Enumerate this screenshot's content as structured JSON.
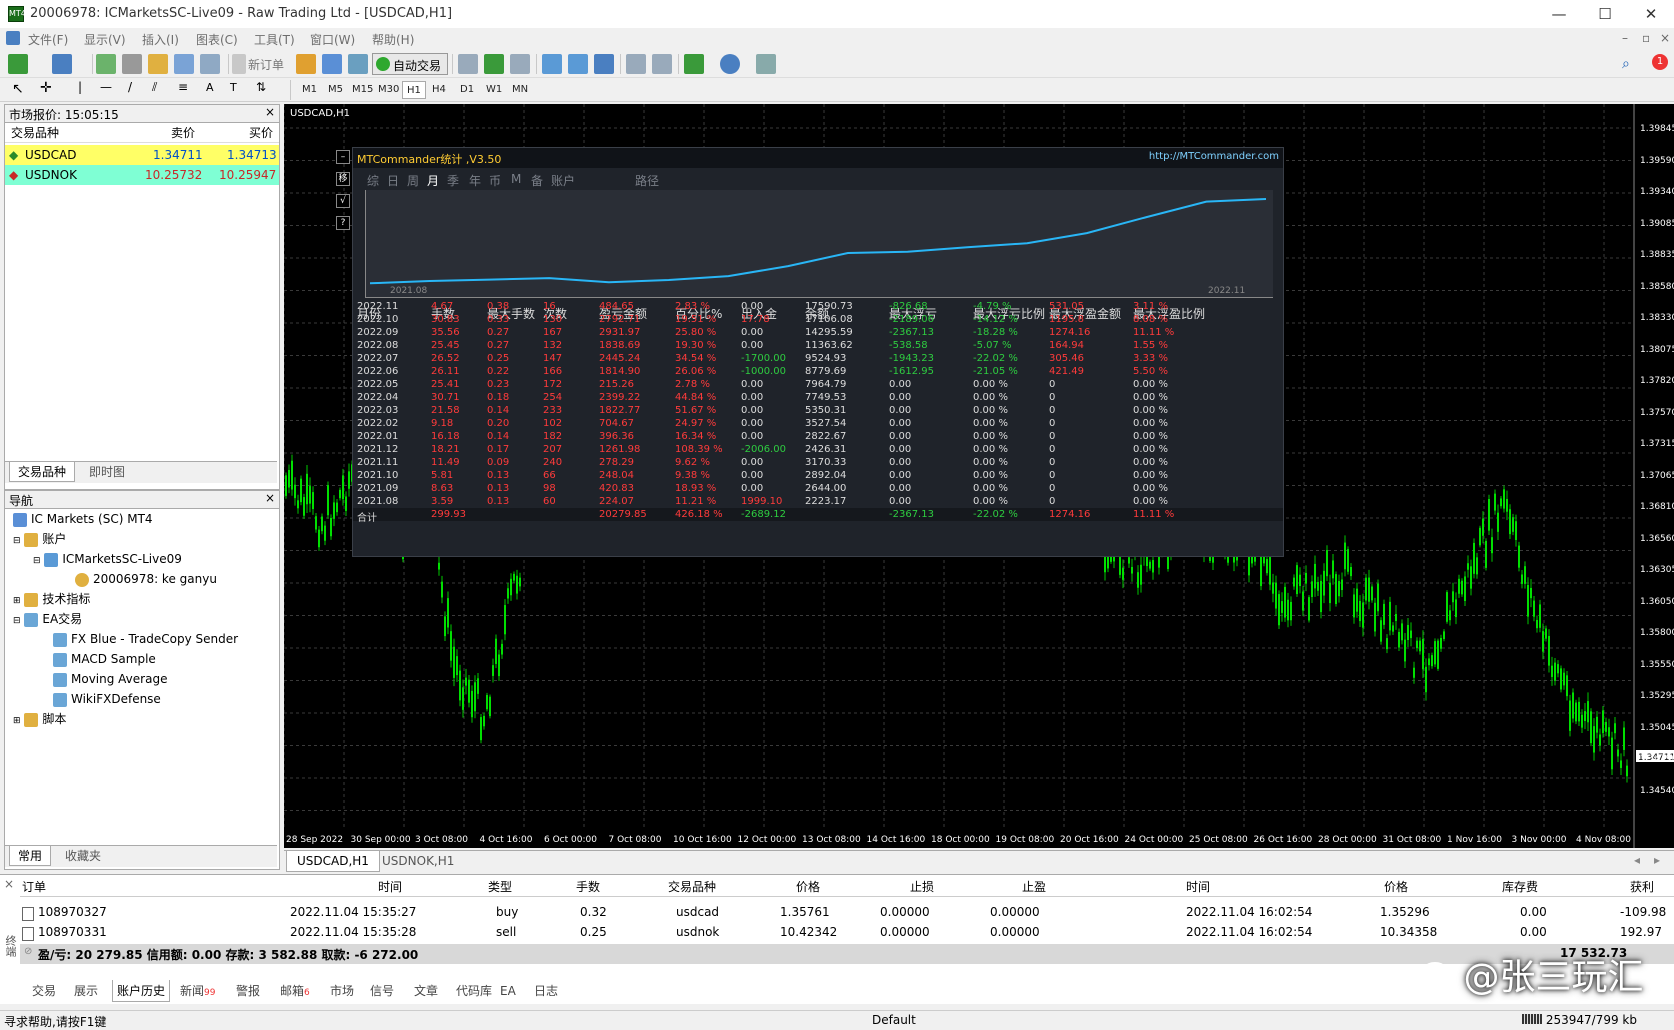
{
  "window": {
    "title": "20006978: ICMarketsSC-Live09 - Raw Trading Ltd - [USDCAD,H1]",
    "app_icon": "MT4"
  },
  "menu": [
    "文件(F)",
    "显示(V)",
    "插入(I)",
    "图表(C)",
    "工具(T)",
    "窗口(W)",
    "帮助(H)"
  ],
  "toolbar": {
    "new_order": "新订单",
    "auto_trade": "自动交易",
    "timeframes": [
      "M1",
      "M5",
      "M15",
      "M30",
      "H1",
      "H4",
      "D1",
      "W1",
      "MN"
    ],
    "active_tf": "H1",
    "notif_count": "1"
  },
  "market_watch": {
    "title": "市场报价: 15:05:15",
    "headers": [
      "交易品种",
      "卖价",
      "买价"
    ],
    "rows": [
      {
        "symbol": "USDCAD",
        "bid": "1.34711",
        "ask": "1.34713"
      },
      {
        "symbol": "USDNOK",
        "bid": "10.25732",
        "ask": "10.25947"
      }
    ],
    "tabs": [
      "交易品种",
      "即时图"
    ]
  },
  "navigator": {
    "title": "导航",
    "items": [
      "IC Markets (SC) MT4",
      "账户",
      "ICMarketsSC-Live09",
      "20006978: ke ganyu",
      "技术指标",
      "EA交易",
      "FX Blue - TradeCopy Sender",
      "MACD Sample",
      "Moving Average",
      "WikiFXDefense",
      "脚本"
    ],
    "tabs": [
      "常用",
      "收藏夹"
    ]
  },
  "chart": {
    "title": "USDCAD,H1",
    "prices": [
      "1.39845",
      "1.39590",
      "1.39340",
      "1.39085",
      "1.38835",
      "1.38580",
      "1.38330",
      "1.38075",
      "1.37820",
      "1.37570",
      "1.37315",
      "1.37065",
      "1.36810",
      "1.36560",
      "1.36305",
      "1.36050",
      "1.35800",
      "1.35550",
      "1.35295",
      "1.35045",
      "1.34790",
      "1.34540"
    ],
    "current_price": "1.34711",
    "times": [
      "28 Sep 2022",
      "30 Sep 00:00",
      "3 Oct 08:00",
      "4 Oct 16:00",
      "6 Oct 00:00",
      "7 Oct 08:00",
      "10 Oct 16:00",
      "12 Oct 00:00",
      "13 Oct 08:00",
      "14 Oct 16:00",
      "18 Oct 00:00",
      "19 Oct 08:00",
      "20 Oct 16:00",
      "24 Oct 00:00",
      "25 Oct 08:00",
      "26 Oct 16:00",
      "28 Oct 00:00",
      "31 Oct 08:00",
      "1 Nov 16:00",
      "3 Nov 00:00",
      "4 Nov 08:00"
    ],
    "tabs": [
      "USDCAD,H1",
      "USDNOK,H1"
    ]
  },
  "mtc": {
    "title": "MTCommander统计 ,V3.50",
    "url": "http://MTCommander.com",
    "tabs": [
      "综",
      "日",
      "周",
      "月",
      "季",
      "年",
      "币",
      "M",
      "备",
      "账户",
      "路径"
    ],
    "active_tab": "月",
    "chart_start": "2021.08",
    "chart_end": "2022.11",
    "headers": [
      "月份",
      "手数",
      "最大手数",
      "次数",
      "盈亏金额",
      "百分比%",
      "出入金",
      "余额",
      "最大浮亏",
      "最大浮亏比例",
      "最大浮盈金额",
      "最大浮盈比例"
    ],
    "rows": [
      [
        "2022.11",
        "4.67",
        "0.38",
        "16",
        "484.65",
        "2.83 %",
        "0.00",
        "17590.73",
        "-826.68",
        "-4.79 %",
        "531.05",
        "3.11 %"
      ],
      [
        "2022.10",
        "30.83",
        "0.33",
        "130",
        "2792.71",
        "19.51 %",
        "17.78",
        "17106.08",
        "-2189.06",
        "-14.12 %",
        "1195.8",
        "8.08 %"
      ],
      [
        "2022.09",
        "35.56",
        "0.27",
        "167",
        "2931.97",
        "25.80 %",
        "0.00",
        "14295.59",
        "-2367.13",
        "-18.28 %",
        "1274.16",
        "11.11 %"
      ],
      [
        "2022.08",
        "25.45",
        "0.27",
        "132",
        "1838.69",
        "19.30 %",
        "0.00",
        "11363.62",
        "-538.58",
        "-5.07 %",
        "164.94",
        "1.55 %"
      ],
      [
        "2022.07",
        "26.52",
        "0.25",
        "147",
        "2445.24",
        "34.54 %",
        "-1700.00",
        "9524.93",
        "-1943.23",
        "-22.02 %",
        "305.46",
        "3.33 %"
      ],
      [
        "2022.06",
        "26.11",
        "0.22",
        "166",
        "1814.90",
        "26.06 %",
        "-1000.00",
        "8779.69",
        "-1612.95",
        "-21.05 %",
        "421.49",
        "5.50 %"
      ],
      [
        "2022.05",
        "25.41",
        "0.23",
        "172",
        "215.26",
        "2.78 %",
        "0.00",
        "7964.79",
        "0.00",
        "0.00 %",
        "0",
        "0.00 %"
      ],
      [
        "2022.04",
        "30.71",
        "0.18",
        "254",
        "2399.22",
        "44.84 %",
        "0.00",
        "7749.53",
        "0.00",
        "0.00 %",
        "0",
        "0.00 %"
      ],
      [
        "2022.03",
        "21.58",
        "0.14",
        "233",
        "1822.77",
        "51.67 %",
        "0.00",
        "5350.31",
        "0.00",
        "0.00 %",
        "0",
        "0.00 %"
      ],
      [
        "2022.02",
        "9.18",
        "0.20",
        "102",
        "704.67",
        "24.97 %",
        "0.00",
        "3527.54",
        "0.00",
        "0.00 %",
        "0",
        "0.00 %"
      ],
      [
        "2022.01",
        "16.18",
        "0.14",
        "182",
        "396.36",
        "16.34 %",
        "0.00",
        "2822.67",
        "0.00",
        "0.00 %",
        "0",
        "0.00 %"
      ],
      [
        "2021.12",
        "18.21",
        "0.17",
        "207",
        "1261.98",
        "108.39 %",
        "-2006.00",
        "2426.31",
        "0.00",
        "0.00 %",
        "0",
        "0.00 %"
      ],
      [
        "2021.11",
        "11.49",
        "0.09",
        "240",
        "278.29",
        "9.62 %",
        "0.00",
        "3170.33",
        "0.00",
        "0.00 %",
        "0",
        "0.00 %"
      ],
      [
        "2021.10",
        "5.81",
        "0.13",
        "66",
        "248.04",
        "9.38 %",
        "0.00",
        "2892.04",
        "0.00",
        "0.00 %",
        "0",
        "0.00 %"
      ],
      [
        "2021.09",
        "8.63",
        "0.13",
        "98",
        "420.83",
        "18.93 %",
        "0.00",
        "2644.00",
        "0.00",
        "0.00 %",
        "0",
        "0.00 %"
      ],
      [
        "2021.08",
        "3.59",
        "0.13",
        "60",
        "224.07",
        "11.21 %",
        "1999.10",
        "2223.17",
        "0.00",
        "0.00 %",
        "0",
        "0.00 %"
      ]
    ],
    "total": [
      "合计",
      "299.93",
      "",
      "",
      "20279.85",
      "426.18 %",
      "-2689.12",
      "",
      "-2367.13",
      "-22.02 %",
      "1274.16",
      "11.11 %"
    ]
  },
  "terminal": {
    "headers": [
      "订单",
      "时间",
      "类型",
      "手数",
      "交易品种",
      "价格",
      "止损",
      "止盈",
      "时间",
      "价格",
      "库存费",
      "获利"
    ],
    "rows": [
      [
        "108970327",
        "2022.11.04 15:35:27",
        "buy",
        "0.32",
        "usdcad",
        "1.35761",
        "0.00000",
        "0.00000",
        "2022.11.04 16:02:54",
        "1.35296",
        "0.00",
        "-109.98"
      ],
      [
        "108970331",
        "2022.11.04 15:35:28",
        "sell",
        "0.25",
        "usdnok",
        "10.42342",
        "0.00000",
        "0.00000",
        "2022.11.04 16:02:54",
        "10.34358",
        "0.00",
        "192.97"
      ]
    ],
    "summary": "盈/亏: 20 279.85  信用额: 0.00  存款: 3 582.88  取款: -6 272.00",
    "summary_total": "17 532.73",
    "tabs": [
      "交易",
      "展示",
      "账户历史",
      "新闻",
      "警报",
      "邮箱",
      "市场",
      "信号",
      "文章",
      "代码库",
      "EA",
      "日志"
    ],
    "news_badge": "99",
    "mail_badge": "6",
    "active_tab": "账户历史",
    "side_label": "终端"
  },
  "status": {
    "help": "寻求帮助,请按F1键",
    "profile": "Default",
    "traffic": "253947/799 kb"
  },
  "watermark": "@张三玩汇",
  "colors": {
    "positive": "#2ecc40",
    "negative": "#ff3b3b",
    "neutral": "#dddddd",
    "candle": "#00d000",
    "mw_row1": "#ffff66",
    "mw_row2": "#7fffd4"
  }
}
